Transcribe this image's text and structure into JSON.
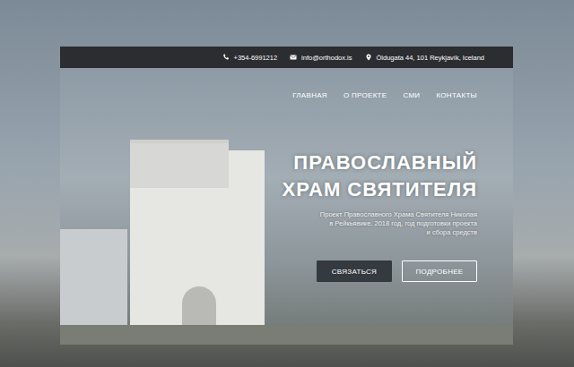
{
  "topbar": {
    "contacts": [
      {
        "kind": "phone",
        "text": "+354-6991212"
      },
      {
        "kind": "mail",
        "text": "info@orthodox.is"
      },
      {
        "kind": "pin",
        "text": "Öldugata 44, 101 Reykjavík, Iceland"
      }
    ]
  },
  "nav": [
    "ГЛАВНАЯ",
    "О ПРОЕКТЕ",
    "СМИ",
    "КОНТАКТЫ"
  ],
  "hero": {
    "title": [
      "ПРАВОСЛАВНЫЙ",
      "ХРАМ СВЯТИТЕЛЯ"
    ],
    "subtitle": [
      "Проект Православного Храма Святителя Николая",
      "в Рейкьявике. 2018 год, год подготовки проекта",
      "и сбора средств"
    ],
    "buttons": [
      {
        "label": "СВЯЗАТЬСЯ",
        "kind": "filled"
      },
      {
        "label": "ПОДРОБНЕЕ",
        "kind": "outline"
      }
    ]
  }
}
